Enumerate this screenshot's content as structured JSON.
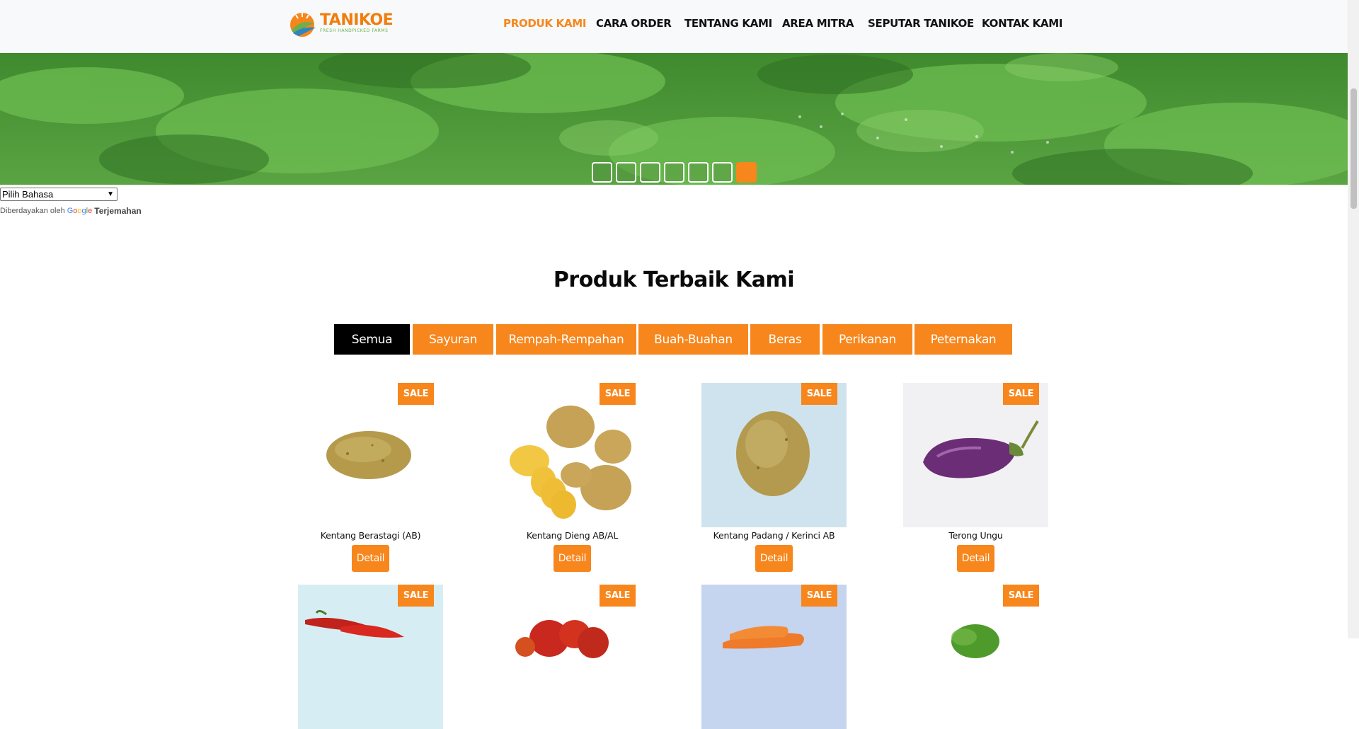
{
  "header": {
    "logo": {
      "name": "TANIKOE",
      "tagline": "FRESH HANDPICKED FARMS"
    },
    "nav": [
      {
        "label": "PRODUK KAMI",
        "active": true
      },
      {
        "label": "CARA ORDER",
        "active": false
      },
      {
        "label": "TENTANG KAMI",
        "active": false
      },
      {
        "label": "AREA MITRA",
        "active": false
      },
      {
        "label": "SEPUTAR TANIKOE",
        "active": false
      },
      {
        "label": "KONTAK KAMI",
        "active": false
      }
    ]
  },
  "hero": {
    "slide_count": 7,
    "active_slide": 7
  },
  "translate": {
    "select_value": "Pilih Bahasa",
    "powered_by": "Diberdayakan oleh",
    "google": "Google",
    "link": "Terjemahan"
  },
  "section": {
    "title": "Produk Terbaik Kami",
    "tabs": [
      {
        "label": "Semua",
        "active": true
      },
      {
        "label": "Sayuran",
        "active": false
      },
      {
        "label": "Rempah-Rempahan",
        "active": false
      },
      {
        "label": "Buah-Buahan",
        "active": false
      },
      {
        "label": "Beras",
        "active": false
      },
      {
        "label": "Perikanan",
        "active": false
      },
      {
        "label": "Peternakan",
        "active": false
      }
    ]
  },
  "products": [
    {
      "name": "Kentang Berastagi (AB)",
      "badge": "SALE",
      "button": "Detail"
    },
    {
      "name": "Kentang Dieng AB/AL",
      "badge": "SALE",
      "button": "Detail"
    },
    {
      "name": "Kentang Padang / Kerinci AB",
      "badge": "SALE",
      "button": "Detail"
    },
    {
      "name": "Terong Ungu",
      "badge": "SALE",
      "button": "Detail"
    },
    {
      "name": "",
      "badge": "SALE",
      "button": ""
    },
    {
      "name": "",
      "badge": "SALE",
      "button": ""
    },
    {
      "name": "",
      "badge": "SALE",
      "button": ""
    },
    {
      "name": "",
      "badge": "SALE",
      "button": ""
    }
  ],
  "colors": {
    "accent": "#f7861c",
    "active_tab": "#000000",
    "nav_text": "#111111"
  }
}
